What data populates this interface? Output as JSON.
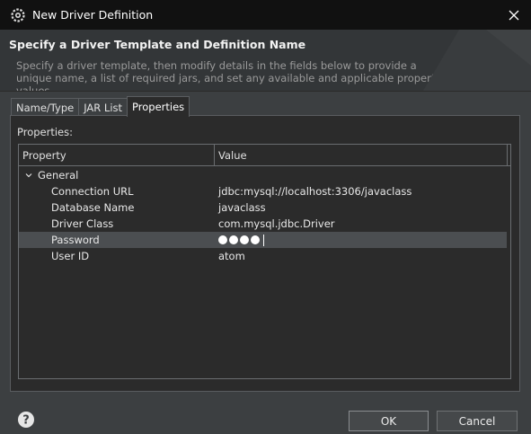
{
  "window": {
    "title": "New Driver Definition",
    "icons": {
      "app": "gear-icon",
      "close": "close-icon"
    }
  },
  "header": {
    "title": "Specify a Driver Template and Definition Name",
    "description": "Specify a driver template, then modify details in the fields below to provide a unique name, a list of required jars, and set any available and applicable property values."
  },
  "tabs": [
    {
      "label": "Name/Type",
      "active": false
    },
    {
      "label": "JAR List",
      "active": false
    },
    {
      "label": "Properties",
      "active": true
    }
  ],
  "properties_panel": {
    "label": "Properties:",
    "columns": [
      "Property",
      "Value"
    ],
    "group": {
      "label": "General",
      "expanded": true,
      "icon": "chevron-down-icon"
    },
    "rows": [
      {
        "property": "Connection URL",
        "value": "jdbc:mysql://localhost:3306/javaclass"
      },
      {
        "property": "Database Name",
        "value": "javaclass"
      },
      {
        "property": "Driver Class",
        "value": "com.mysql.jdbc.Driver"
      },
      {
        "property": "Password",
        "value": "",
        "masked_chars": 4,
        "selected": true
      },
      {
        "property": "User ID",
        "value": "atom"
      }
    ]
  },
  "footer": {
    "help_icon": "help-icon",
    "ok_label": "OK",
    "cancel_label": "Cancel"
  },
  "colors": {
    "title_bar": "#111111",
    "dialog_bg": "#3c3f41",
    "panel_bg": "#2b2b2b",
    "selected_row": "#4b4e51"
  }
}
